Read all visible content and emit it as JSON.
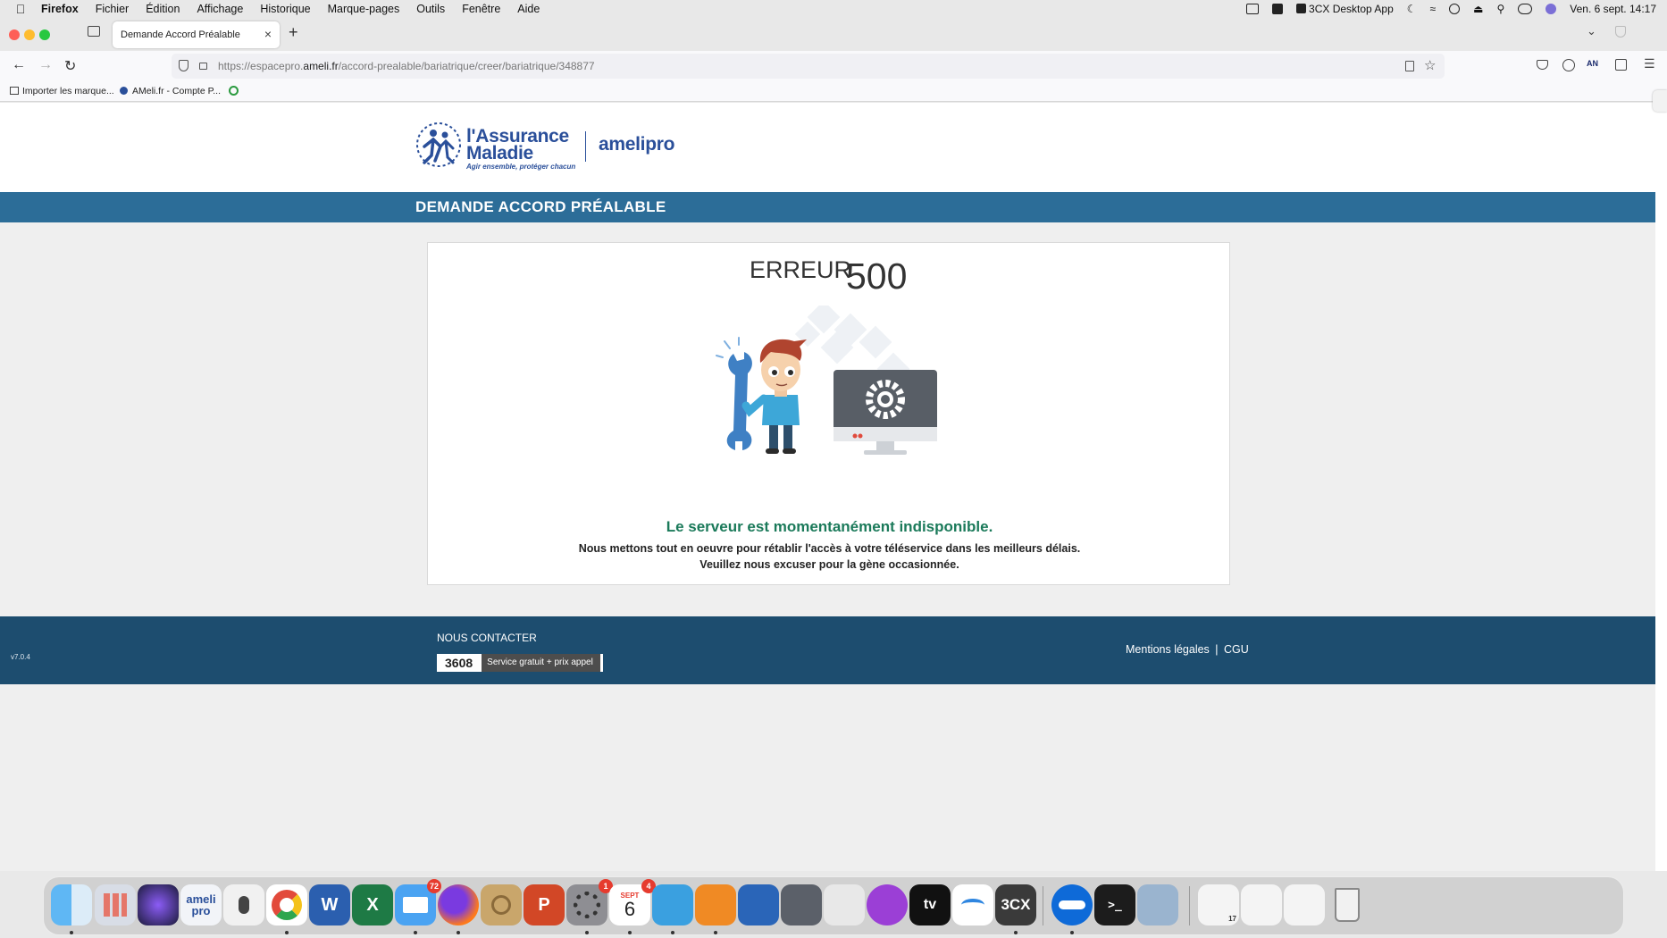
{
  "menubar": {
    "app": "Firefox",
    "items": [
      "Fichier",
      "Édition",
      "Affichage",
      "Historique",
      "Marque-pages",
      "Outils",
      "Fenêtre",
      "Aide"
    ],
    "status_app": "3CX Desktop App",
    "datetime": "Ven. 6 sept.  14:17"
  },
  "browser": {
    "tab_title": "Demande Accord Préalable",
    "url_prefix": "https://espacepro.",
    "url_domain": "ameli.fr",
    "url_path": "/accord-prealable/bariatrique/creer/bariatrique/348877",
    "bookmarks": [
      "Importer les marque...",
      "AMeli.fr - Compte P..."
    ]
  },
  "page": {
    "logo": {
      "line1": "l'Assurance",
      "line2": "Maladie",
      "tagline": "Agir ensemble, protéger chacun",
      "product": "amelipro"
    },
    "section_title": "DEMANDE ACCORD PRÉALABLE",
    "error": {
      "word": "ERREUR",
      "code": "500",
      "headline": "Le serveur est momentanément indisponible.",
      "detail_line1": "Nous mettons tout en oeuvre pour rétablir l'accès à votre téléservice dans les meilleurs délais.",
      "detail_line2": "Veuillez nous excuser pour la gène occasionnée."
    },
    "footer": {
      "version": "v7.0.4",
      "contact_title": "NOUS CONTACTER",
      "phone_number": "3608",
      "phone_note": "Service gratuit + prix appel",
      "legal_link": "Mentions légales",
      "separator": "|",
      "cgu_link": "CGU"
    }
  },
  "dock": {
    "mail_badge": "72",
    "settings_badge": "1",
    "calendar_month": "SEPT",
    "calendar_day": "6",
    "calendar_badge": "4",
    "ameli_app_label": "ameli pro",
    "threecx_label": "3CX",
    "tv_label": "tv",
    "dock_calendar_small": "17"
  },
  "colors": {
    "title_bar": "#2c6d98",
    "footer": "#1d4d6f",
    "headline": "#1b7a5a",
    "logo_blue": "#2a4f9a"
  }
}
